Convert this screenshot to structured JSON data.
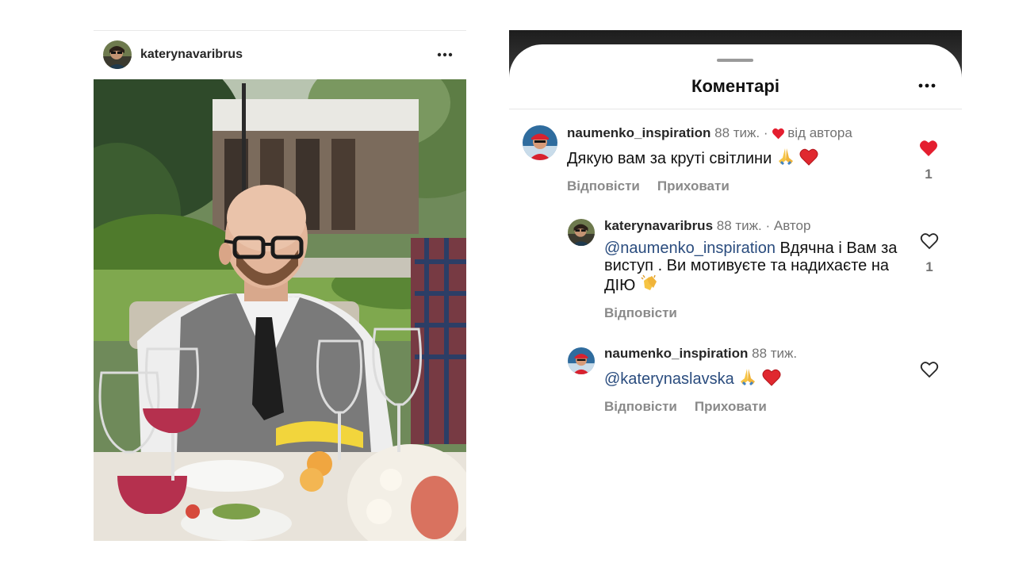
{
  "post": {
    "username": "katerynavaribrus",
    "more_icon": "more-horizontal-icon"
  },
  "sheet": {
    "title": "Коментарі",
    "more_icon": "more-horizontal-icon"
  },
  "comments": [
    {
      "username": "naumenko_inspiration",
      "time": "88 тиж.",
      "separator": "·",
      "author_like_label": "від автора",
      "text": "Дякую вам за круті світлини",
      "reply_label": "Відповісти",
      "hide_label": "Приховати",
      "liked": true,
      "like_count": "1",
      "accent_color": "#e41e2f"
    },
    {
      "username": "katerynavaribrus",
      "time": "88 тиж.",
      "separator": "·",
      "author_badge": "Автор",
      "mention": "@naumenko_inspiration",
      "text": " Вдячна і Вам за виступ . Ви мотивуєте та надихаєте на ДІЮ",
      "reply_label": "Відповісти",
      "liked": false,
      "like_count": "1"
    },
    {
      "username": "naumenko_inspiration",
      "time": "88 тиж.",
      "mention": "@katerynaslavska",
      "reply_label": "Відповісти",
      "hide_label": "Приховати",
      "liked": false
    }
  ],
  "colors": {
    "mention": "#2a4c7e",
    "like_red": "#e41e2f",
    "secondary_text": "#737373"
  }
}
